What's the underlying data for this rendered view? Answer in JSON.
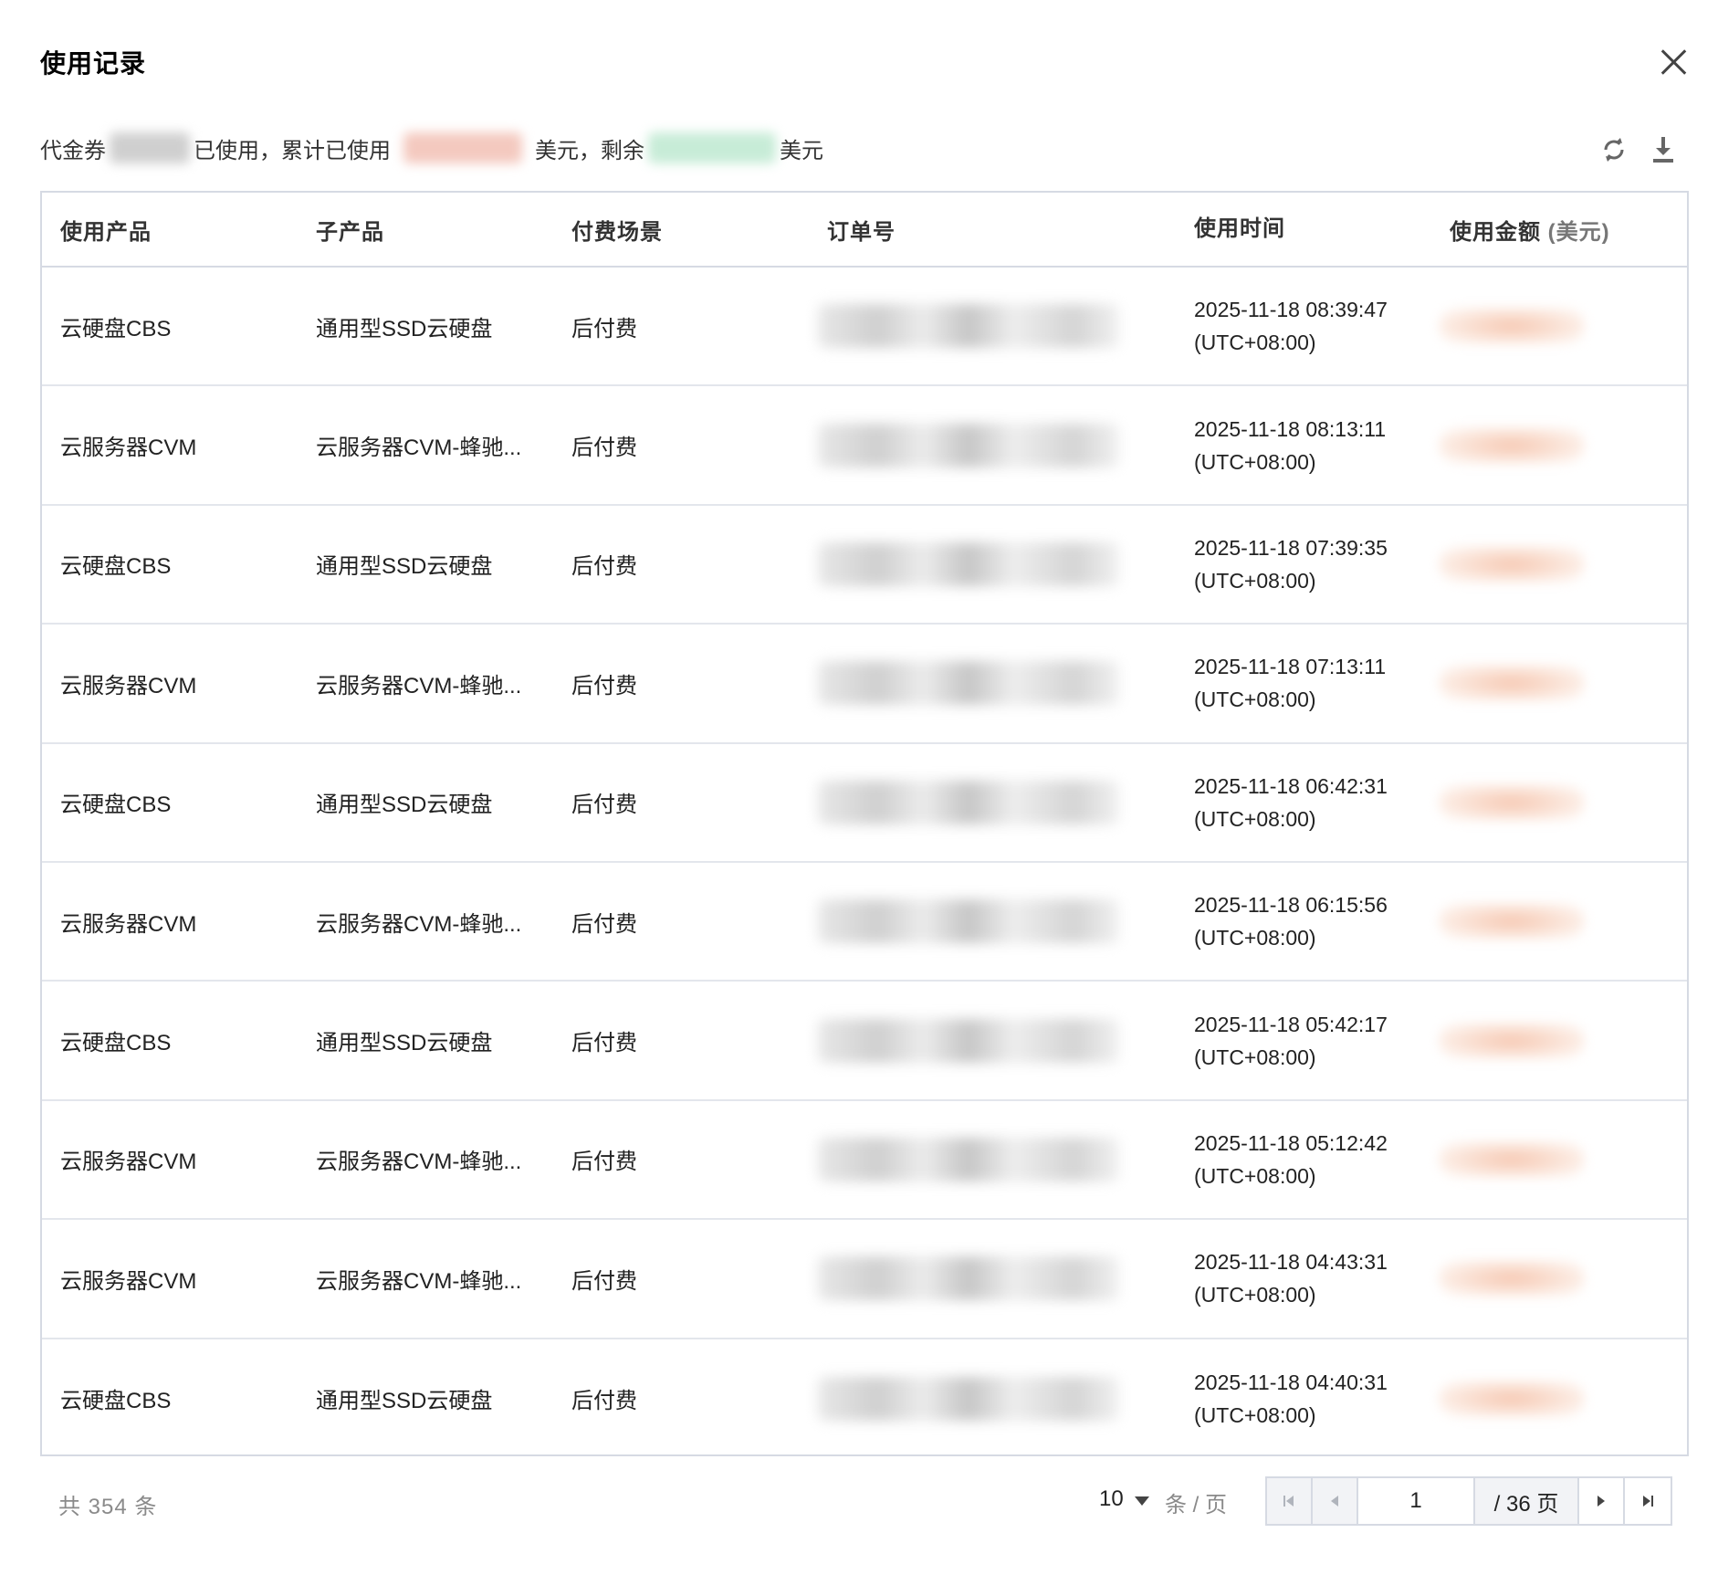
{
  "dialog": {
    "title": "使用记录",
    "close_icon": "close-icon"
  },
  "summary": {
    "prefix": "代金券",
    "used_label": "已使用，累计已使用",
    "unit1": "美元，剩余",
    "unit2": "美元"
  },
  "toolbar": {
    "refresh_icon": "refresh-icon",
    "download_icon": "download-icon"
  },
  "table": {
    "headers": [
      "使用产品",
      "子产品",
      "付费场景",
      "订单号",
      "使用时间",
      "使用金额 ",
      "(美元)"
    ],
    "rows": [
      {
        "product": "云硬盘CBS",
        "sub": "通用型SSD云硬盘",
        "scene": "后付费",
        "time1": "2025-11-18 08:39:47",
        "time2": "(UTC+08:00)"
      },
      {
        "product": "云服务器CVM",
        "sub": "云服务器CVM-蜂驰...",
        "scene": "后付费",
        "time1": "2025-11-18 08:13:11",
        "time2": "(UTC+08:00)"
      },
      {
        "product": "云硬盘CBS",
        "sub": "通用型SSD云硬盘",
        "scene": "后付费",
        "time1": "2025-11-18 07:39:35",
        "time2": "(UTC+08:00)"
      },
      {
        "product": "云服务器CVM",
        "sub": "云服务器CVM-蜂驰...",
        "scene": "后付费",
        "time1": "2025-11-18 07:13:11",
        "time2": "(UTC+08:00)"
      },
      {
        "product": "云硬盘CBS",
        "sub": "通用型SSD云硬盘",
        "scene": "后付费",
        "time1": "2025-11-18 06:42:31",
        "time2": "(UTC+08:00)"
      },
      {
        "product": "云服务器CVM",
        "sub": "云服务器CVM-蜂驰...",
        "scene": "后付费",
        "time1": "2025-11-18 06:15:56",
        "time2": "(UTC+08:00)"
      },
      {
        "product": "云硬盘CBS",
        "sub": "通用型SSD云硬盘",
        "scene": "后付费",
        "time1": "2025-11-18 05:42:17",
        "time2": "(UTC+08:00)"
      },
      {
        "product": "云服务器CVM",
        "sub": "云服务器CVM-蜂驰...",
        "scene": "后付费",
        "time1": "2025-11-18 05:12:42",
        "time2": "(UTC+08:00)"
      },
      {
        "product": "云服务器CVM",
        "sub": "云服务器CVM-蜂驰...",
        "scene": "后付费",
        "time1": "2025-11-18 04:43:31",
        "time2": "(UTC+08:00)"
      },
      {
        "product": "云硬盘CBS",
        "sub": "通用型SSD云硬盘",
        "scene": "后付费",
        "time1": "2025-11-18 04:40:31",
        "time2": "(UTC+08:00)"
      }
    ]
  },
  "pagination": {
    "total": "共 354 条",
    "page_size": "10",
    "per_page_label": "条 / 页",
    "current_page": "1",
    "total_pages": "/ 36 页",
    "first_icon": "first-page-icon",
    "prev_icon": "prev-page-icon",
    "next_icon": "next-page-icon",
    "last_icon": "last-page-icon"
  }
}
